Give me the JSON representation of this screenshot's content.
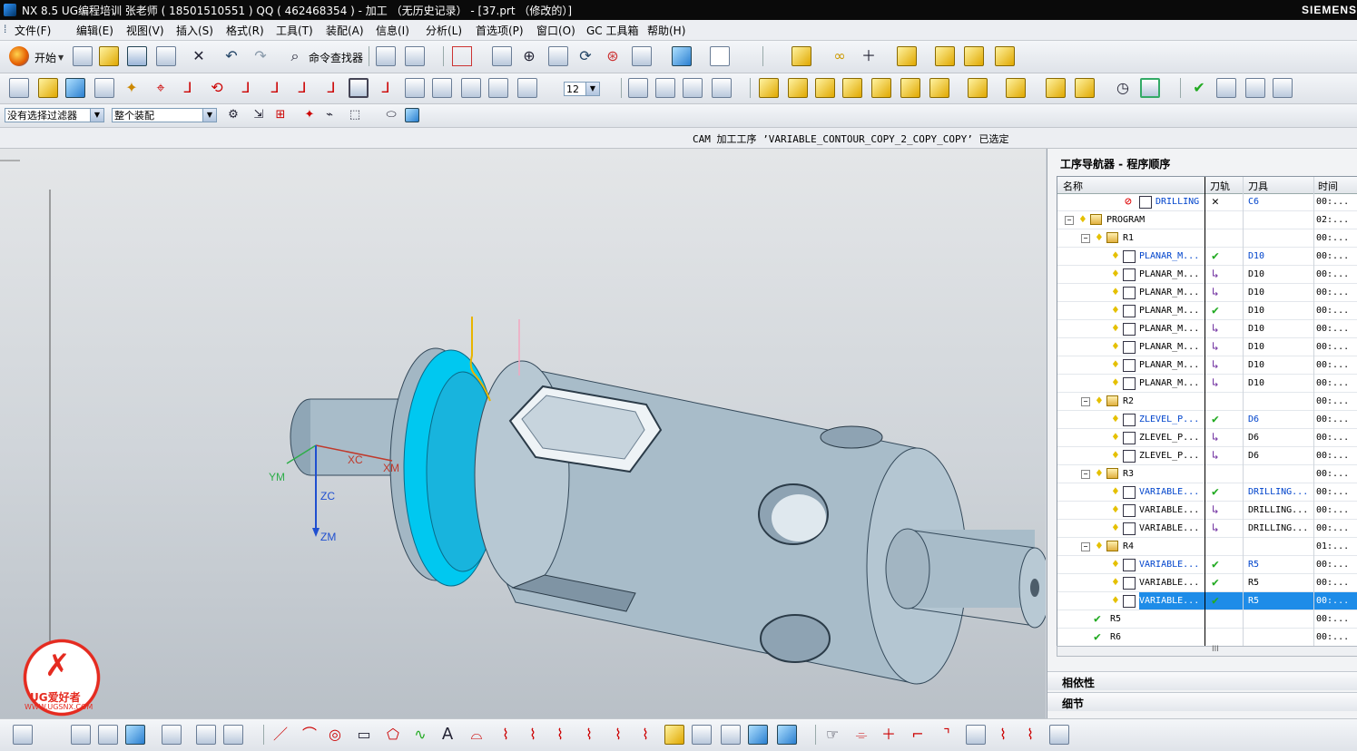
{
  "window": {
    "title": "NX 8.5  UG编程培训 张老师 ( 18501510551 ) QQ ( 462468354 )  - 加工 （无历史记录） - [37.prt （修改的）]",
    "brand": "SIEMENS"
  },
  "menu": [
    "文件(F)",
    "编辑(E)",
    "视图(V)",
    "插入(S)",
    "格式(R)",
    "工具(T)",
    "装配(A)",
    "信息(I)",
    "分析(L)",
    "首选项(P)",
    "窗口(O)",
    "GC 工具箱",
    "帮助(H)"
  ],
  "toolbar1": {
    "start_label": "开始",
    "command_finder_label": "命令查找器"
  },
  "toolbar2": {
    "layer_value": "12"
  },
  "toolbar3": {
    "filter_value": "没有选择过滤器",
    "scope_value": "整个装配"
  },
  "cue": {
    "message": "CAM 加工工序 ’VARIABLE_CONTOUR_COPY_2_COPY_COPY’ 已选定"
  },
  "viewport": {
    "axis_labels": {
      "ym": "YM",
      "xc": "XC",
      "xm": "XM",
      "zc": "ZC",
      "zm": "ZM"
    },
    "watermark_site": "WWW.UGSNX.COM",
    "watermark_name": "UG爱好者"
  },
  "navigator": {
    "title": "工序导航器 - 程序顺序",
    "columns": [
      "名称",
      "刀轨",
      "刀具",
      "时间"
    ],
    "rows": [
      {
        "level": 3,
        "type": "op",
        "name": "DRILLING",
        "status": "✕",
        "tool": "C6",
        "time": "00:...",
        "blue": true,
        "bulb": false,
        "forbidden": true
      },
      {
        "level": 0,
        "type": "group",
        "name": "PROGRAM",
        "status": "",
        "tool": "",
        "time": "02:...",
        "toggle": "−"
      },
      {
        "level": 1,
        "type": "group",
        "name": "R1",
        "status": "",
        "tool": "",
        "time": "00:...",
        "toggle": "−"
      },
      {
        "level": 2,
        "type": "op",
        "name": "PLANAR_M...",
        "status": "✔",
        "tool": "D10",
        "time": "00:...",
        "blue": true
      },
      {
        "level": 2,
        "type": "op",
        "name": "PLANAR_M...",
        "status": "↳",
        "tool": "D10",
        "time": "00:..."
      },
      {
        "level": 2,
        "type": "op",
        "name": "PLANAR_M...",
        "status": "↳",
        "tool": "D10",
        "time": "00:..."
      },
      {
        "level": 2,
        "type": "op",
        "name": "PLANAR_M...",
        "status": "✔",
        "tool": "D10",
        "time": "00:..."
      },
      {
        "level": 2,
        "type": "op",
        "name": "PLANAR_M...",
        "status": "↳",
        "tool": "D10",
        "time": "00:..."
      },
      {
        "level": 2,
        "type": "op",
        "name": "PLANAR_M...",
        "status": "↳",
        "tool": "D10",
        "time": "00:..."
      },
      {
        "level": 2,
        "type": "op",
        "name": "PLANAR_M...",
        "status": "↳",
        "tool": "D10",
        "time": "00:..."
      },
      {
        "level": 2,
        "type": "op",
        "name": "PLANAR_M...",
        "status": "↳",
        "tool": "D10",
        "time": "00:..."
      },
      {
        "level": 1,
        "type": "group",
        "name": "R2",
        "status": "",
        "tool": "",
        "time": "00:...",
        "toggle": "−"
      },
      {
        "level": 2,
        "type": "op",
        "name": "ZLEVEL_P...",
        "status": "✔",
        "tool": "D6",
        "time": "00:...",
        "blue": true
      },
      {
        "level": 2,
        "type": "op",
        "name": "ZLEVEL_P...",
        "status": "↳",
        "tool": "D6",
        "time": "00:..."
      },
      {
        "level": 2,
        "type": "op",
        "name": "ZLEVEL_P...",
        "status": "↳",
        "tool": "D6",
        "time": "00:..."
      },
      {
        "level": 1,
        "type": "group",
        "name": "R3",
        "status": "",
        "tool": "",
        "time": "00:...",
        "toggle": "−"
      },
      {
        "level": 2,
        "type": "op",
        "name": "VARIABLE...",
        "status": "✔",
        "tool": "DRILLING...",
        "time": "00:...",
        "blue": true
      },
      {
        "level": 2,
        "type": "op",
        "name": "VARIABLE...",
        "status": "↳",
        "tool": "DRILLING...",
        "time": "00:..."
      },
      {
        "level": 2,
        "type": "op",
        "name": "VARIABLE...",
        "status": "↳",
        "tool": "DRILLING...",
        "time": "00:..."
      },
      {
        "level": 1,
        "type": "group",
        "name": "R4",
        "status": "",
        "tool": "",
        "time": "01:...",
        "toggle": "−"
      },
      {
        "level": 2,
        "type": "op",
        "name": "VARIABLE...",
        "status": "✔",
        "tool": "R5",
        "time": "00:...",
        "blue": true
      },
      {
        "level": 2,
        "type": "op",
        "name": "VARIABLE...",
        "status": "✔",
        "tool": "R5",
        "time": "00:..."
      },
      {
        "level": 2,
        "type": "op",
        "name": "VARIABLE...",
        "status": "✔",
        "tool": "R5",
        "time": "00:...",
        "selected": true
      },
      {
        "level": 1,
        "type": "group-done",
        "name": "R5",
        "status": "",
        "tool": "",
        "time": "00:..."
      },
      {
        "level": 1,
        "type": "group-done",
        "name": "R6",
        "status": "",
        "tool": "",
        "time": "00:..."
      }
    ],
    "panels": [
      "相依性",
      "细节"
    ]
  },
  "colors": {
    "selection": "#1e8ce8",
    "face_highlight": "#00c8f0",
    "part_body": "#a8bcc9",
    "check": "#22aa22",
    "arrow": "#7030a0"
  }
}
